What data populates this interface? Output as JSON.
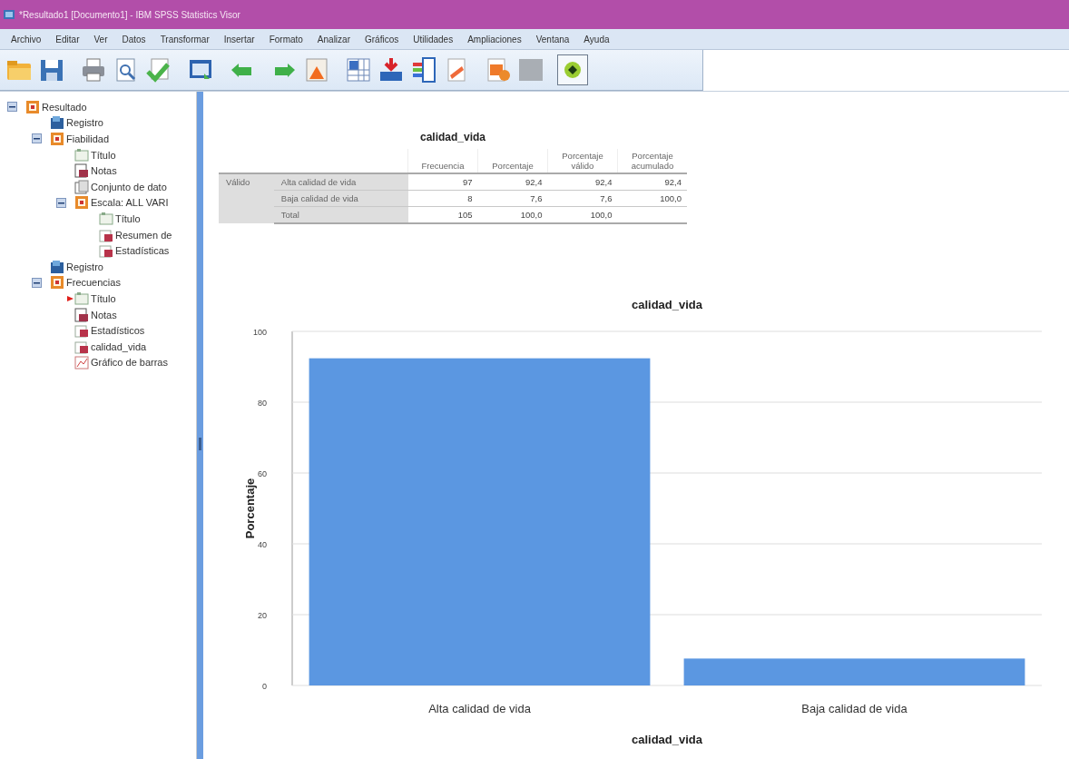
{
  "window": {
    "title": "*Resultado1 [Documento1] - IBM SPSS Statistics Visor"
  },
  "menu": [
    "Archivo",
    "Editar",
    "Ver",
    "Datos",
    "Transformar",
    "Insertar",
    "Formato",
    "Analizar",
    "Gráficos",
    "Utilidades",
    "Ampliaciones",
    "Ventana",
    "Ayuda"
  ],
  "toolbar": [
    {
      "kind": "open",
      "selected": false
    },
    {
      "kind": "save",
      "selected": false
    },
    {
      "kind": "print",
      "selected": false
    },
    {
      "kind": "preview",
      "selected": false
    },
    {
      "kind": "export",
      "selected": false
    },
    {
      "kind": "dialog",
      "selected": false
    },
    {
      "kind": "undo",
      "selected": false
    },
    {
      "kind": "redo",
      "selected": false
    },
    {
      "kind": "goto",
      "selected": false
    },
    {
      "kind": "grid",
      "selected": false
    },
    {
      "kind": "insert",
      "selected": false
    },
    {
      "kind": "bars",
      "selected": false
    },
    {
      "kind": "doc",
      "selected": false
    },
    {
      "kind": "doc2",
      "selected": false
    },
    {
      "kind": "blank",
      "selected": false
    },
    {
      "kind": "dot",
      "selected": true
    }
  ],
  "outline": [
    {
      "label": "Resultado",
      "kind": "folder",
      "expanded": true,
      "current": false,
      "children": [
        {
          "label": "Registro",
          "kind": "log",
          "current": false
        },
        {
          "label": "Fiabilidad",
          "kind": "folder",
          "expanded": true,
          "current": false,
          "children": [
            {
              "label": "Título",
              "kind": "title",
              "current": false
            },
            {
              "label": "Notas",
              "kind": "notes",
              "current": false
            },
            {
              "label": "Conjunto de dato",
              "kind": "dataset",
              "current": false
            },
            {
              "label": "Escala: ALL VARI",
              "kind": "folder",
              "expanded": true,
              "current": false,
              "children": [
                {
                  "label": "Título",
                  "kind": "title",
                  "current": false
                },
                {
                  "label": "Resumen de",
                  "kind": "table",
                  "current": false
                },
                {
                  "label": "Estadísticas",
                  "kind": "table",
                  "current": false
                }
              ]
            }
          ]
        },
        {
          "label": "Registro",
          "kind": "log",
          "current": false
        },
        {
          "label": "Frecuencias",
          "kind": "folder",
          "expanded": true,
          "current": false,
          "children": [
            {
              "label": "Título",
              "kind": "title",
              "current": true
            },
            {
              "label": "Notas",
              "kind": "notes",
              "current": false
            },
            {
              "label": "Estadísticos",
              "kind": "table",
              "current": false
            },
            {
              "label": "calidad_vida",
              "kind": "table",
              "current": false
            },
            {
              "label": "Gráfico de barras",
              "kind": "chart",
              "current": false
            }
          ]
        }
      ]
    }
  ],
  "table": {
    "title": "calidad_vida",
    "columns": [
      "Frecuencia",
      "Porcentaje",
      "Porcentaje válido",
      "Porcentaje acumulado"
    ],
    "group": "Válido",
    "rows": [
      {
        "label": "Alta calidad de vida",
        "cells": [
          "97",
          "92,4",
          "92,4",
          "92,4"
        ]
      },
      {
        "label": "Baja calidad de vida",
        "cells": [
          "8",
          "7,6",
          "7,6",
          "100,0"
        ]
      },
      {
        "label": "Total",
        "cells": [
          "105",
          "100,0",
          "100,0"
        ]
      }
    ]
  },
  "chart": {
    "chart_data": {
      "type": "bar",
      "title": "calidad_vida",
      "xlabel": "calidad_vida",
      "ylabel": "Porcentaje",
      "categories": [
        "Alta calidad de vida",
        "Baja calidad de vida"
      ],
      "series": [
        {
          "color": "#5b97e1",
          "values": [
            92.4,
            7.6
          ]
        }
      ],
      "grid": true,
      "ylim": [
        0,
        100
      ],
      "yticks": [
        0,
        20,
        40,
        60,
        80,
        100
      ]
    }
  }
}
